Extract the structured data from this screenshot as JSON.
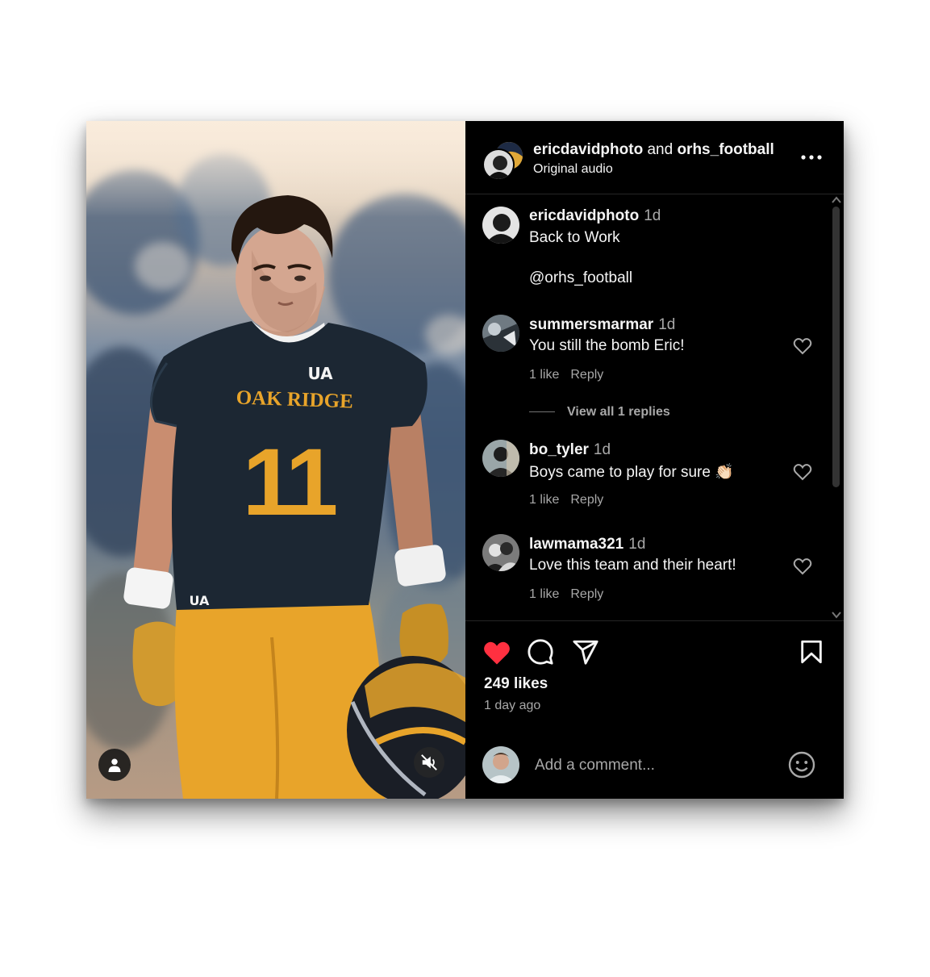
{
  "header": {
    "author": "ericdavidphoto",
    "joiner": "and",
    "collaborator": "orhs_football",
    "audio": "Original audio"
  },
  "caption": {
    "username": "ericdavidphoto",
    "time": "1d",
    "line1": "Back to Work",
    "line2": "@orhs_football"
  },
  "comments": [
    {
      "username": "summersmarmar",
      "time": "1d",
      "text": "You still the bomb Eric!",
      "likes": "1 like",
      "reply": "Reply"
    },
    {
      "username": "bo_tyler",
      "time": "1d",
      "text": "Boys came to play for sure 👏🏻",
      "likes": "1 like",
      "reply": "Reply"
    },
    {
      "username": "lawmama321",
      "time": "1d",
      "text": "Love this team and their heart!",
      "likes": "1 like",
      "reply": "Reply"
    }
  ],
  "view_replies": "View all 1 replies",
  "stats": {
    "likes": "249 likes",
    "time_ago": "1 day ago"
  },
  "add_comment": {
    "placeholder": "Add a comment..."
  },
  "jersey": {
    "team": "OAK RIDGE",
    "number": "11"
  },
  "icons": {
    "more": "more-horizontal-icon",
    "heart": "heart-icon",
    "comment": "comment-icon",
    "share": "share-icon",
    "bookmark": "bookmark-icon",
    "emoji": "emoji-icon",
    "user_tag": "person-icon",
    "mute": "speaker-muted-icon"
  },
  "colors": {
    "background": "#000000",
    "text_primary": "#f5f5f5",
    "text_secondary": "#a8a8a8",
    "liked_heart": "#ff3040",
    "jersey_gold": "#e8a42a",
    "jersey_navy": "#1c2733"
  }
}
